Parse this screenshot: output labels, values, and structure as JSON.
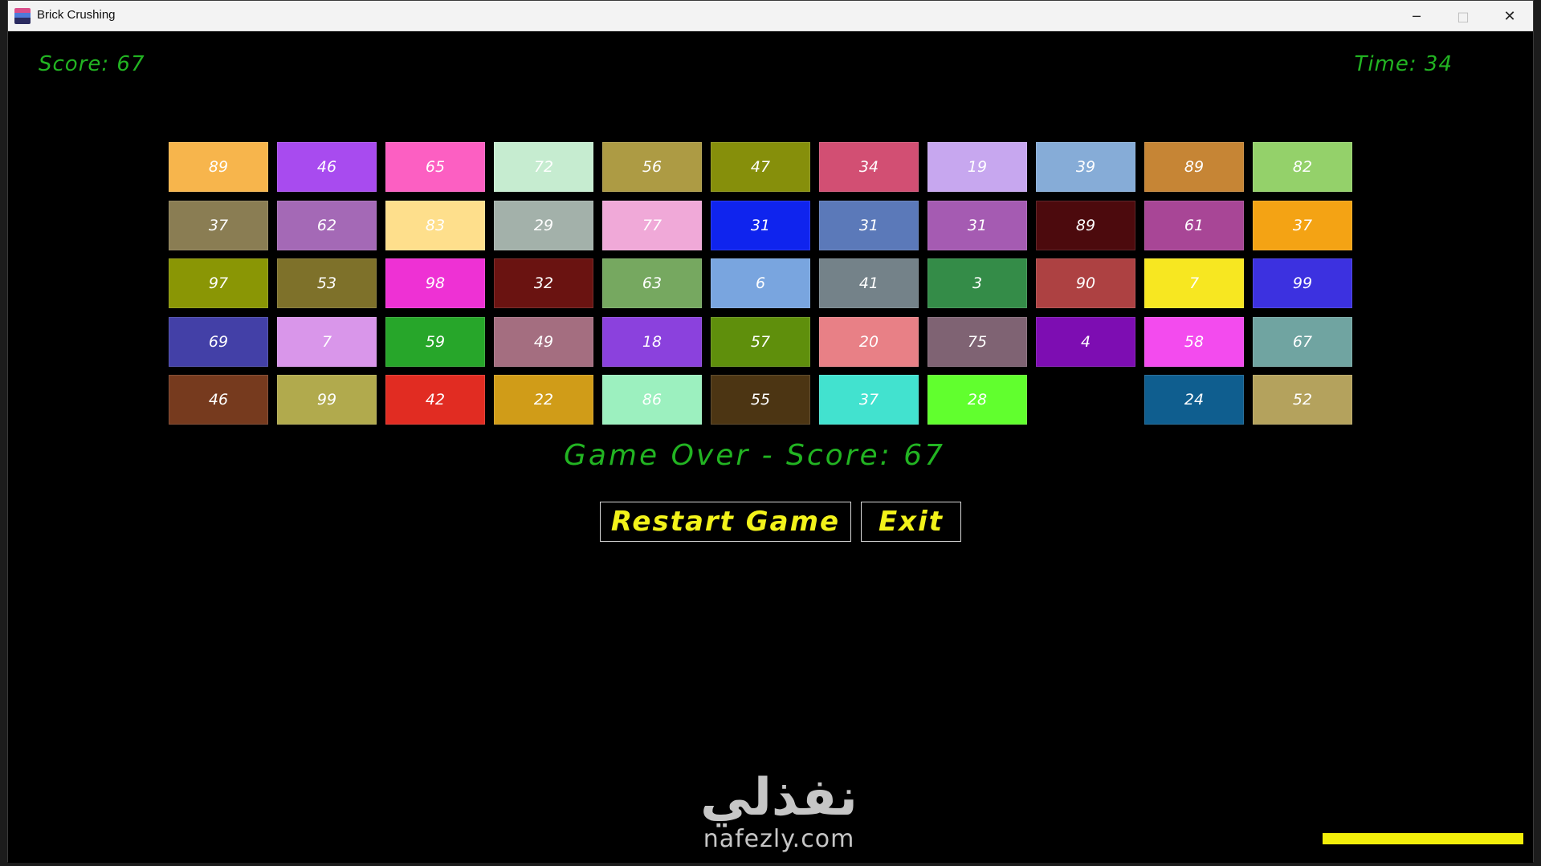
{
  "window": {
    "title": "Brick Crushing",
    "controls": {
      "minimize": "─",
      "maximize": "□",
      "close": "✕"
    }
  },
  "hud": {
    "score_label": "Score: 67",
    "time_label": "Time: 34"
  },
  "bricks": [
    [
      {
        "value": "89",
        "color": "#f7b54c"
      },
      {
        "value": "46",
        "color": "#a84bef"
      },
      {
        "value": "65",
        "color": "#fc5fc2"
      },
      {
        "value": "72",
        "color": "#c6ecd0"
      },
      {
        "value": "56",
        "color": "#ad9b44"
      },
      {
        "value": "47",
        "color": "#868f0b"
      },
      {
        "value": "34",
        "color": "#d24f73"
      },
      {
        "value": "19",
        "color": "#c7a7ef"
      },
      {
        "value": "39",
        "color": "#86acd7"
      },
      {
        "value": "89",
        "color": "#c68535"
      },
      {
        "value": "82",
        "color": "#94d16a"
      }
    ],
    [
      {
        "value": "37",
        "color": "#8a7d53"
      },
      {
        "value": "62",
        "color": "#a469b6"
      },
      {
        "value": "83",
        "color": "#fedf8c"
      },
      {
        "value": "29",
        "color": "#a3b1aa"
      },
      {
        "value": "77",
        "color": "#f0a9d8"
      },
      {
        "value": "31",
        "color": "#0f24ee"
      },
      {
        "value": "31",
        "color": "#5b79b9"
      },
      {
        "value": "31",
        "color": "#a55bb2"
      },
      {
        "value": "89",
        "color": "#4c0a0d"
      },
      {
        "value": "61",
        "color": "#a84696"
      },
      {
        "value": "37",
        "color": "#f4a314"
      }
    ],
    [
      {
        "value": "97",
        "color": "#8a9605"
      },
      {
        "value": "53",
        "color": "#7e712a"
      },
      {
        "value": "98",
        "color": "#ee31d4"
      },
      {
        "value": "32",
        "color": "#6a1311"
      },
      {
        "value": "63",
        "color": "#76a860"
      },
      {
        "value": "6",
        "color": "#79a5df"
      },
      {
        "value": "41",
        "color": "#748289"
      },
      {
        "value": "3",
        "color": "#348c48"
      },
      {
        "value": "90",
        "color": "#ad4142"
      },
      {
        "value": "7",
        "color": "#f7e721"
      },
      {
        "value": "99",
        "color": "#3c31e0"
      }
    ],
    [
      {
        "value": "69",
        "color": "#4340a7"
      },
      {
        "value": "7",
        "color": "#d996ea"
      },
      {
        "value": "59",
        "color": "#27a62a"
      },
      {
        "value": "49",
        "color": "#a46e80"
      },
      {
        "value": "18",
        "color": "#8b41dd"
      },
      {
        "value": "57",
        "color": "#5f8f0c"
      },
      {
        "value": "20",
        "color": "#e88086"
      },
      {
        "value": "75",
        "color": "#7f6373"
      },
      {
        "value": "4",
        "color": "#7d0db2"
      },
      {
        "value": "58",
        "color": "#f34bee"
      },
      {
        "value": "67",
        "color": "#70a4a1"
      }
    ],
    [
      {
        "value": "46",
        "color": "#763a1e"
      },
      {
        "value": "99",
        "color": "#b1aa4d"
      },
      {
        "value": "42",
        "color": "#e12c22"
      },
      {
        "value": "22",
        "color": "#d09c18"
      },
      {
        "value": "86",
        "color": "#9cf0bf"
      },
      {
        "value": "55",
        "color": "#4c3513"
      },
      {
        "value": "37",
        "color": "#42e2cf"
      },
      {
        "value": "28",
        "color": "#61ff2e"
      },
      null,
      {
        "value": "24",
        "color": "#0f5e8f"
      },
      {
        "value": "52",
        "color": "#b4a25d"
      }
    ]
  ],
  "status": {
    "game_over_text": "Game Over - Score: 67"
  },
  "buttons": {
    "restart_label": "Restart Game",
    "exit_label": "Exit"
  },
  "paddle": {
    "color": "#f2ee0a"
  },
  "watermark": {
    "arabic": "نفذلي",
    "latin": "nafezly.com"
  }
}
